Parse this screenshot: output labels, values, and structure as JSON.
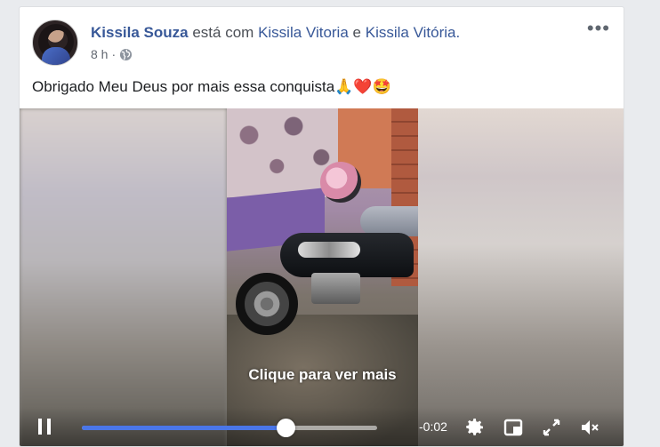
{
  "post": {
    "author": "Kissila Souza",
    "with_text": "está com",
    "tagged_1": "Kissila Vitoria",
    "conjunction": "e",
    "tagged_2": "Kissila Vitória.",
    "time": "8 h",
    "separator": "·",
    "privacy_icon": "globe-icon",
    "more_label": "•••",
    "text": "Obrigado Meu Deus por mais essa conquista",
    "emojis": "🙏❤️🤩"
  },
  "video": {
    "overlay_text": "Clique para ver mais",
    "time_remaining": "-0:02",
    "progress": 0.69,
    "icons": [
      "pause-icon",
      "settings-gear-icon",
      "picture-in-picture-icon",
      "fullscreen-icon",
      "volume-muted-icon"
    ]
  },
  "colors": {
    "link": "#385898",
    "progress": "#4a76e8",
    "background": "#e9ebee"
  }
}
